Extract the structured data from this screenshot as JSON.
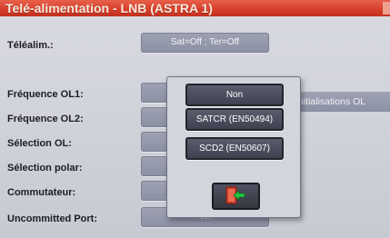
{
  "window": {
    "title": "Telé-alimentation - LNB (ASTRA 1)"
  },
  "rows": [
    {
      "label": "Téléalim.:",
      "value": "Sat=Off ; Ter=Off"
    },
    {
      "label": "Fréquence OL1:",
      "value": ""
    },
    {
      "label": "Fréquence OL2:",
      "value": ""
    },
    {
      "label": "Sélection OL:",
      "value": ""
    },
    {
      "label": "Sélection polar:",
      "value": ""
    },
    {
      "label": "Commutateur:",
      "value": ""
    },
    {
      "label": "Uncommitted Port:",
      "value": "Non"
    }
  ],
  "side_button": {
    "label": "nitialisations OL"
  },
  "popup": {
    "options": [
      "Non",
      "SATCR (EN50494)",
      "SCD2 (EN50607)"
    ],
    "exit_icon": "exit-door-icon"
  }
}
